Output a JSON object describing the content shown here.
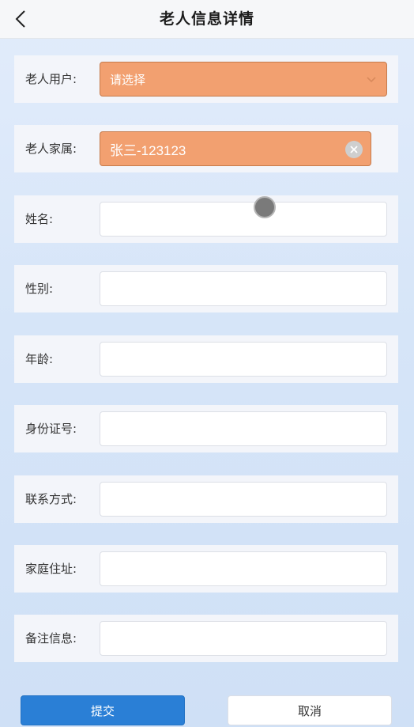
{
  "header": {
    "title": "老人信息详情",
    "back_icon": "chevron-left-icon"
  },
  "form": {
    "elder_user": {
      "label": "老人用户:",
      "placeholder": "请选择",
      "icon": "chevron-down-icon",
      "color": "#f2a070"
    },
    "family": {
      "label": "老人家属:",
      "value": "张三-123123",
      "icon": "clear-icon",
      "color": "#f2a070"
    },
    "name": {
      "label": "姓名:",
      "value": ""
    },
    "gender": {
      "label": "性别:",
      "value": ""
    },
    "age": {
      "label": "年龄:",
      "value": ""
    },
    "id_number": {
      "label": "身份证号:",
      "value": ""
    },
    "contact": {
      "label": "联系方式:",
      "value": ""
    },
    "address": {
      "label": "家庭住址:",
      "value": ""
    },
    "remarks": {
      "label": "备注信息:",
      "value": ""
    }
  },
  "actions": {
    "submit_label": "提交",
    "cancel_label": "取消",
    "submit_color": "#2a7fd6"
  }
}
